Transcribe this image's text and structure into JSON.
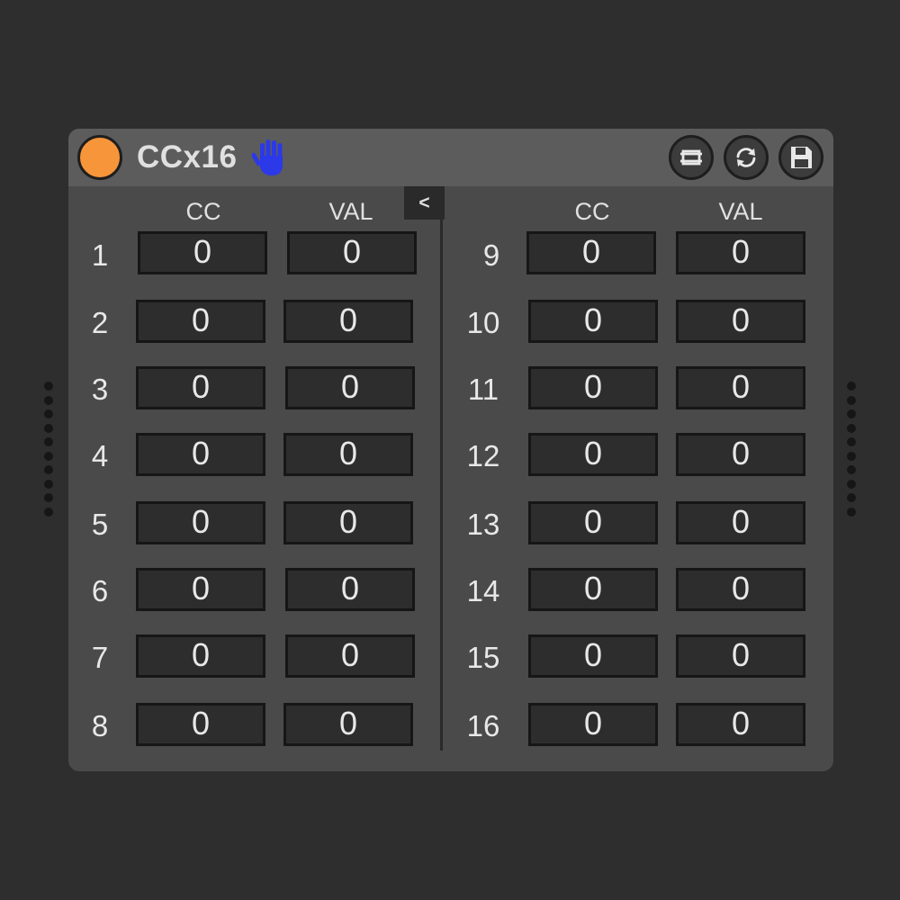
{
  "device": {
    "title": "CCx16",
    "power_color": "#f7953a",
    "icons": {
      "hand": "hand-icon",
      "map": "map-icon",
      "refresh": "refresh-icon",
      "save": "save-icon"
    },
    "collapse_label": "<"
  },
  "headers": {
    "cc": "CC",
    "val": "VAL"
  },
  "left_rows": [
    {
      "num": "1",
      "cc": "0",
      "val": "0"
    },
    {
      "num": "2",
      "cc": "0",
      "val": "0"
    },
    {
      "num": "3",
      "cc": "0",
      "val": "0"
    },
    {
      "num": "4",
      "cc": "0",
      "val": "0"
    },
    {
      "num": "5",
      "cc": "0",
      "val": "0"
    },
    {
      "num": "6",
      "cc": "0",
      "val": "0"
    },
    {
      "num": "7",
      "cc": "0",
      "val": "0"
    },
    {
      "num": "8",
      "cc": "0",
      "val": "0"
    }
  ],
  "right_rows": [
    {
      "num": "9",
      "cc": "0",
      "val": "0"
    },
    {
      "num": "10",
      "cc": "0",
      "val": "0"
    },
    {
      "num": "11",
      "cc": "0",
      "val": "0"
    },
    {
      "num": "12",
      "cc": "0",
      "val": "0"
    },
    {
      "num": "13",
      "cc": "0",
      "val": "0"
    },
    {
      "num": "14",
      "cc": "0",
      "val": "0"
    },
    {
      "num": "15",
      "cc": "0",
      "val": "0"
    },
    {
      "num": "16",
      "cc": "0",
      "val": "0"
    }
  ]
}
